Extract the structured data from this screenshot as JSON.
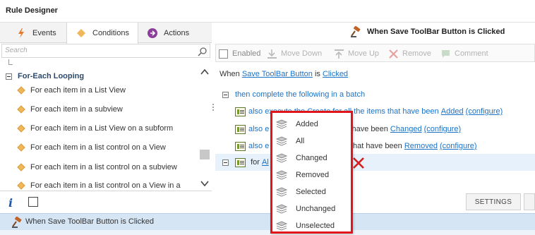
{
  "window": {
    "title": "Rule Designer"
  },
  "tabs": [
    {
      "label": "Events",
      "icon": "lightning-icon",
      "color": "#e8792b"
    },
    {
      "label": "Conditions",
      "icon": "diamond-icon",
      "color": "#f0b85a",
      "active": true
    },
    {
      "label": "Actions",
      "icon": "arrow-circle-icon",
      "color": "#8b3f9a"
    }
  ],
  "search": {
    "placeholder": "Search"
  },
  "conditions": {
    "group_label": "For-Each Looping",
    "items": [
      "For each item in a List View",
      "For each item in a subview",
      "For each item in a List View on a subform",
      "For each item in a list control on a View",
      "For each item in a list control on a subview",
      "For each item in a list control on a View in a"
    ]
  },
  "rule": {
    "header_title": "When Save ToolBar Button is Clicked",
    "toolbar": {
      "enabled_label": "Enabled",
      "move_down_label": "Move Down",
      "move_up_label": "Move Up",
      "remove_label": "Remove",
      "comment_label": "Comment"
    },
    "event_line": {
      "prefix": "When",
      "control": "Save ToolBar Button",
      "middle": "is",
      "event": "Clicked"
    },
    "batch_line": "then complete the following in a batch",
    "actions": [
      {
        "also": "also",
        "pre": "execute the",
        "method": "Create",
        "post": "for all the items that have been",
        "state": "Added",
        "configure": "(configure)"
      },
      {
        "also": "also",
        "pre": "e",
        "post": "the items that have been",
        "state": "Changed",
        "configure": "(configure)"
      },
      {
        "also": "also",
        "pre": "e",
        "post": "ll the items that have been",
        "state": "Removed",
        "configure": "(configure)"
      }
    ],
    "for_line": {
      "prefix": "for",
      "value": "Al"
    }
  },
  "dropdown": {
    "options": [
      "Added",
      "All",
      "Changed",
      "Removed",
      "Selected",
      "Unchanged",
      "Unselected"
    ],
    "highlight_color": "#e0161c"
  },
  "footer": {
    "settings_label": "SETTINGS"
  },
  "status_bar": {
    "text": "When Save ToolBar Button is Clicked"
  },
  "colors": {
    "link": "#1a73c8",
    "accent_blue": "#1b5aa8",
    "status_bg": "#d6e5f4"
  }
}
